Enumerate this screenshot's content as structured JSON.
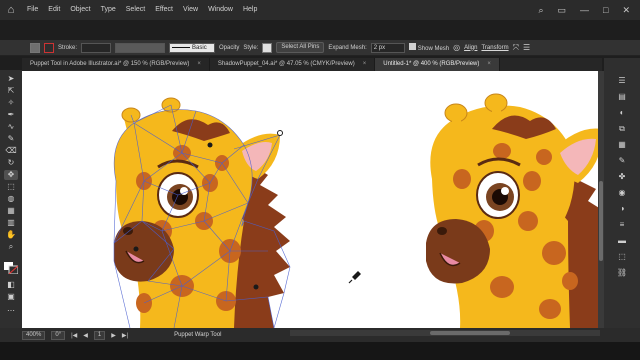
{
  "menubar": {
    "items": [
      "File",
      "Edit",
      "Object",
      "Type",
      "Select",
      "Effect",
      "View",
      "Window",
      "Help"
    ]
  },
  "controlbar": {
    "stroke_label": "Stroke:",
    "brush_label": "Basic",
    "opacity_label": "Opacity",
    "style_label": "Style:",
    "select_all_pins": "Select All Pins",
    "expand_mesh_label": "Expand Mesh:",
    "expand_mesh_value": "2 px",
    "show_mesh_label": "Show Mesh",
    "align_label": "Align",
    "transform_label": "Transform"
  },
  "tabs": [
    {
      "label": "Puppet Tool in Adobe Illustrator.ai* @ 150 % (RGB/Preview)",
      "close": "×"
    },
    {
      "label": "ShadowPuppet_04.ai* @ 47.05 % (CMYK/Preview)",
      "close": "×"
    },
    {
      "label": "Untitled-1* @ 400 % (RGB/Preview)",
      "close": "×"
    }
  ],
  "statusbar": {
    "zoom": "400%",
    "rotation": "0°",
    "artboard": "1",
    "tool_name": "Puppet Warp Tool"
  },
  "colors": {
    "giraffe_yellow": "#f5b81c",
    "giraffe_spot": "#c8661f",
    "giraffe_brown": "#8a3c1a",
    "mesh_blue": "#4a5fd0"
  }
}
